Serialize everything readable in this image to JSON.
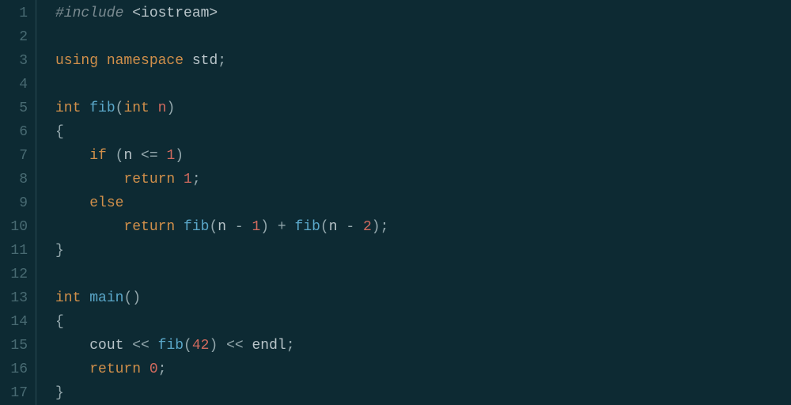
{
  "editor": {
    "language": "cpp",
    "gutter": [
      "1",
      "2",
      "3",
      "4",
      "5",
      "6",
      "7",
      "8",
      "9",
      "10",
      "11",
      "12",
      "13",
      "14",
      "15",
      "16",
      "17"
    ],
    "lines": [
      [
        {
          "t": "#include ",
          "c": "kw-preproc"
        },
        {
          "t": "<iostream>",
          "c": "string-hdr"
        }
      ],
      [],
      [
        {
          "t": "using ",
          "c": "kw-using"
        },
        {
          "t": "namespace ",
          "c": "kw-using"
        },
        {
          "t": "std",
          "c": "ns"
        },
        {
          "t": ";",
          "c": "punct"
        }
      ],
      [],
      [
        {
          "t": "int ",
          "c": "kw-type"
        },
        {
          "t": "fib",
          "c": "fn"
        },
        {
          "t": "(",
          "c": "punct"
        },
        {
          "t": "int ",
          "c": "kw-type"
        },
        {
          "t": "n",
          "c": "param"
        },
        {
          "t": ")",
          "c": "punct"
        }
      ],
      [
        {
          "t": "{",
          "c": "punct"
        }
      ],
      [
        {
          "t": "    ",
          "c": "ident"
        },
        {
          "t": "if ",
          "c": "kw-ctrl"
        },
        {
          "t": "(",
          "c": "punct"
        },
        {
          "t": "n ",
          "c": "ident"
        },
        {
          "t": "<= ",
          "c": "op"
        },
        {
          "t": "1",
          "c": "num"
        },
        {
          "t": ")",
          "c": "punct"
        }
      ],
      [
        {
          "t": "        ",
          "c": "ident"
        },
        {
          "t": "return ",
          "c": "kw-ret"
        },
        {
          "t": "1",
          "c": "num"
        },
        {
          "t": ";",
          "c": "punct"
        }
      ],
      [
        {
          "t": "    ",
          "c": "ident"
        },
        {
          "t": "else",
          "c": "kw-ctrl"
        }
      ],
      [
        {
          "t": "        ",
          "c": "ident"
        },
        {
          "t": "return ",
          "c": "kw-ret"
        },
        {
          "t": "fib",
          "c": "call"
        },
        {
          "t": "(",
          "c": "punct"
        },
        {
          "t": "n ",
          "c": "ident"
        },
        {
          "t": "- ",
          "c": "op"
        },
        {
          "t": "1",
          "c": "num"
        },
        {
          "t": ") ",
          "c": "punct"
        },
        {
          "t": "+ ",
          "c": "op"
        },
        {
          "t": "fib",
          "c": "call"
        },
        {
          "t": "(",
          "c": "punct"
        },
        {
          "t": "n ",
          "c": "ident"
        },
        {
          "t": "- ",
          "c": "op"
        },
        {
          "t": "2",
          "c": "num"
        },
        {
          "t": ")",
          "c": "punct"
        },
        {
          "t": ";",
          "c": "punct"
        }
      ],
      [
        {
          "t": "}",
          "c": "punct"
        }
      ],
      [],
      [
        {
          "t": "int ",
          "c": "kw-type"
        },
        {
          "t": "main",
          "c": "fn"
        },
        {
          "t": "()",
          "c": "punct"
        }
      ],
      [
        {
          "t": "{",
          "c": "punct"
        }
      ],
      [
        {
          "t": "    ",
          "c": "ident"
        },
        {
          "t": "cout ",
          "c": "ident"
        },
        {
          "t": "<< ",
          "c": "op"
        },
        {
          "t": "fib",
          "c": "call"
        },
        {
          "t": "(",
          "c": "punct"
        },
        {
          "t": "42",
          "c": "num"
        },
        {
          "t": ") ",
          "c": "punct"
        },
        {
          "t": "<< ",
          "c": "op"
        },
        {
          "t": "endl",
          "c": "ident"
        },
        {
          "t": ";",
          "c": "punct"
        }
      ],
      [
        {
          "t": "    ",
          "c": "ident"
        },
        {
          "t": "return ",
          "c": "kw-ret"
        },
        {
          "t": "0",
          "c": "num"
        },
        {
          "t": ";",
          "c": "punct"
        }
      ],
      [
        {
          "t": "}",
          "c": "punct"
        }
      ]
    ]
  }
}
